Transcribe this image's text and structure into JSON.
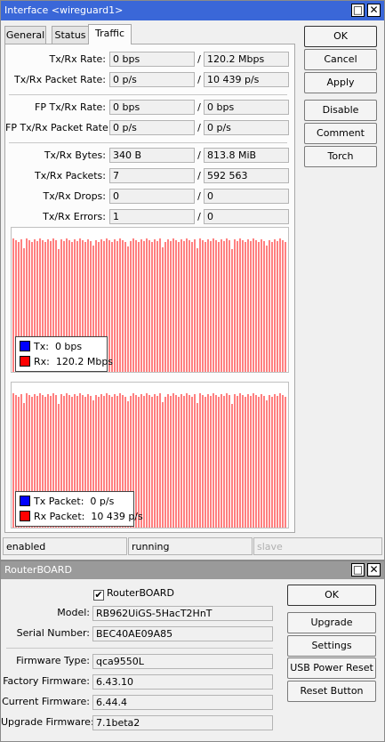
{
  "interface_window": {
    "title": "Interface <wireguard1>",
    "title_bar_color": "#3a67d8",
    "tabs": [
      {
        "label": "General"
      },
      {
        "label": "Status"
      },
      {
        "label": "Traffic"
      }
    ],
    "active_tab": "Traffic",
    "fields": {
      "txrx_rate": {
        "label": "Tx/Rx Rate:",
        "tx": "0 bps",
        "rx": "120.2 Mbps"
      },
      "txrx_packet_rate": {
        "label": "Tx/Rx Packet Rate:",
        "tx": "0 p/s",
        "rx": "10 439 p/s"
      },
      "fp_txrx_rate": {
        "label": "FP Tx/Rx Rate:",
        "tx": "0 bps",
        "rx": "0 bps"
      },
      "fp_txrx_packet_rate": {
        "label": "FP Tx/Rx Packet Rate:",
        "tx": "0 p/s",
        "rx": "0 p/s"
      },
      "txrx_bytes": {
        "label": "Tx/Rx Bytes:",
        "tx": "340 B",
        "rx": "813.8 MiB"
      },
      "txrx_packets": {
        "label": "Tx/Rx Packets:",
        "tx": "7",
        "rx": "592 563"
      },
      "txrx_drops": {
        "label": "Tx/Rx Drops:",
        "tx": "0",
        "rx": "0"
      },
      "txrx_errors": {
        "label": "Tx/Rx Errors:",
        "tx": "1",
        "rx": "0"
      }
    },
    "separator": "/",
    "graph_rate": {
      "legend_tx": {
        "label": "Tx:",
        "value": "0 bps",
        "color": "#0000ff"
      },
      "legend_rx": {
        "label": "Rx:",
        "value": "120.2 Mbps",
        "color": "#ff0000"
      }
    },
    "graph_packets": {
      "legend_tx": {
        "label": "Tx Packet:",
        "value": "0 p/s",
        "color": "#0000ff"
      },
      "legend_rx": {
        "label": "Rx Packet:",
        "value": "10 439 p/s",
        "color": "#ff0000"
      }
    },
    "buttons": {
      "ok": "OK",
      "cancel": "Cancel",
      "apply": "Apply",
      "disable": "Disable",
      "comment": "Comment",
      "torch": "Torch"
    },
    "status_bar": {
      "state": "enabled",
      "running": "running",
      "slave": "slave"
    }
  },
  "routerboard_window": {
    "title": "RouterBOARD",
    "title_bar_color": "#9a9a9a",
    "checkbox": {
      "label": "RouterBOARD",
      "checked": true
    },
    "fields": {
      "model": {
        "label": "Model:",
        "value": "RB962UiGS-5HacT2HnT"
      },
      "serial": {
        "label": "Serial Number:",
        "value": "BEC40AE09A85"
      },
      "firmware_type": {
        "label": "Firmware Type:",
        "value": "qca9550L"
      },
      "factory_firmware": {
        "label": "Factory Firmware:",
        "value": "6.43.10"
      },
      "current_firmware": {
        "label": "Current Firmware:",
        "value": "6.44.4"
      },
      "upgrade_firmware": {
        "label": "Upgrade Firmware:",
        "value": "7.1beta2"
      }
    },
    "buttons": {
      "ok": "OK",
      "upgrade": "Upgrade",
      "settings": "Settings",
      "usb_power_reset": "USB Power Reset",
      "reset_button": "Reset Button"
    }
  }
}
